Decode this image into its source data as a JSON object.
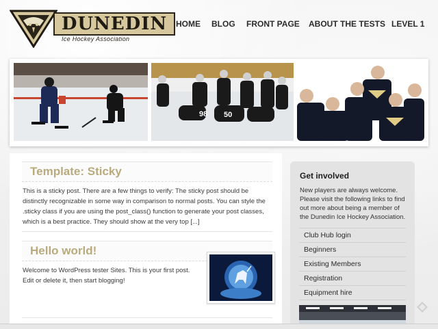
{
  "logo": {
    "name": "DUNEDIN",
    "subtitle": "Ice Hockey Association"
  },
  "nav": {
    "items": [
      {
        "label": "HOME"
      },
      {
        "label": "BLOG"
      },
      {
        "label": "FRONT PAGE"
      },
      {
        "label": "ABOUT THE TESTS"
      },
      {
        "label": "LEVEL 1"
      }
    ]
  },
  "banner": {
    "photos": [
      "ice-hockey-game-photo",
      "youth-hockey-team-on-ice-photo",
      "junior-players-group-photo"
    ],
    "jersey_numbers": [
      "98",
      "50"
    ]
  },
  "posts": [
    {
      "title": "Template: Sticky",
      "excerpt_lines": [
        "This is a sticky post. There are a few things to verify: The sticky post should be",
        "distinctly recognizable in some way in comparison to normal posts. You can style the",
        ".sticky class if you are using the post_class() function to generate your post classes,",
        "which is a best practice. They should show at the very top [...]"
      ]
    },
    {
      "title": "Hello world!",
      "excerpt_lines": [
        "Welcome to WordPress tester Sites. This is your first post.",
        "Edit or delete it, then start blogging!"
      ],
      "thumbnail": "unicorn-moon-image"
    }
  ],
  "sidebar": {
    "title": "Get involved",
    "text_lines": [
      "New players are always welcome.",
      "Please visit the following links to find",
      "out more about being a member of",
      "the Dunedin Ice Hockey Association."
    ],
    "links": [
      {
        "label": "Club Hub login"
      },
      {
        "label": "Beginners"
      },
      {
        "label": "Existing Members"
      },
      {
        "label": "Registration"
      },
      {
        "label": "Equipment hire"
      }
    ],
    "image": "ice-rink-image"
  },
  "colors": {
    "accent_gold": "#b9ab7d",
    "logo_gold": "#d6c79c",
    "nav_text": "#2b2b2b"
  }
}
